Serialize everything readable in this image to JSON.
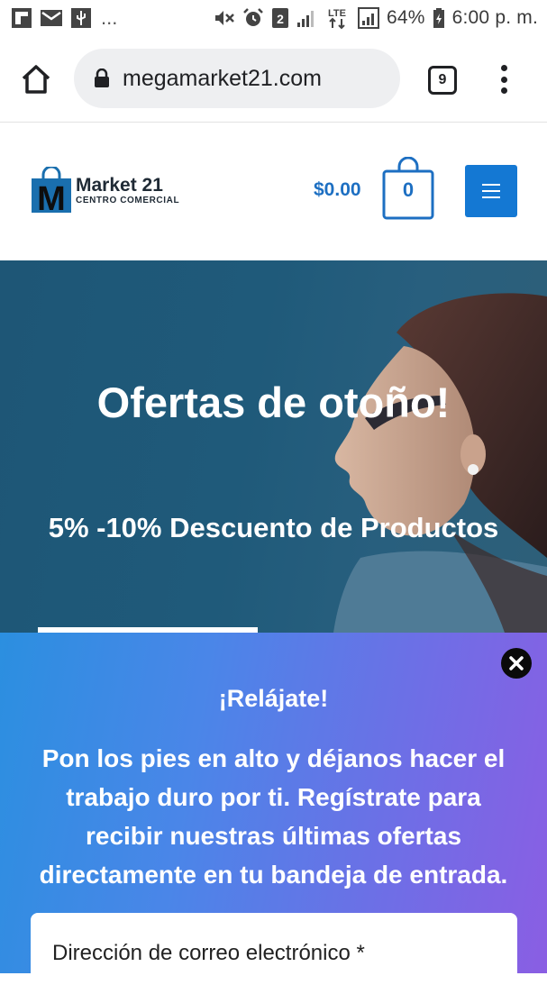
{
  "status_bar": {
    "left_icons": [
      "flipboard-icon",
      "mail-icon",
      "usb-icon"
    ],
    "more": "...",
    "right_icons": [
      "mute-icon",
      "alarm-icon",
      "sim-2-icon",
      "signal-icon",
      "lte-icon",
      "signal-icon"
    ],
    "sim_badge": "2",
    "lte": "LTE",
    "battery": "64%",
    "time": "6:00 p. m."
  },
  "browser": {
    "url": "megamarket21.com",
    "tabs_count": "9"
  },
  "header": {
    "logo_letter": "M",
    "logo_name": "Market 21",
    "logo_sub": "CENTRO COMERCIAL",
    "cart_total": "$0.00",
    "cart_count": "0"
  },
  "hero": {
    "title": "Ofertas de otoño!",
    "subtitle": "5% -10% Descuento de Productos"
  },
  "popup": {
    "title": "¡Relájate!",
    "body": "Pon los pies en alto y déjanos hacer el trabajo duro por ti. Regístrate para recibir nuestras últimas ofertas directamente en tu bandeja de entrada.",
    "email_placeholder": "Dirección de correo electrónico *"
  },
  "colors": {
    "accent": "#1478d3",
    "cart_blue": "#1d6fc2",
    "hero_bg": "#1f5a7a",
    "popup_gradient_start": "#2b8fe0",
    "popup_gradient_end": "#8a5ee3"
  }
}
